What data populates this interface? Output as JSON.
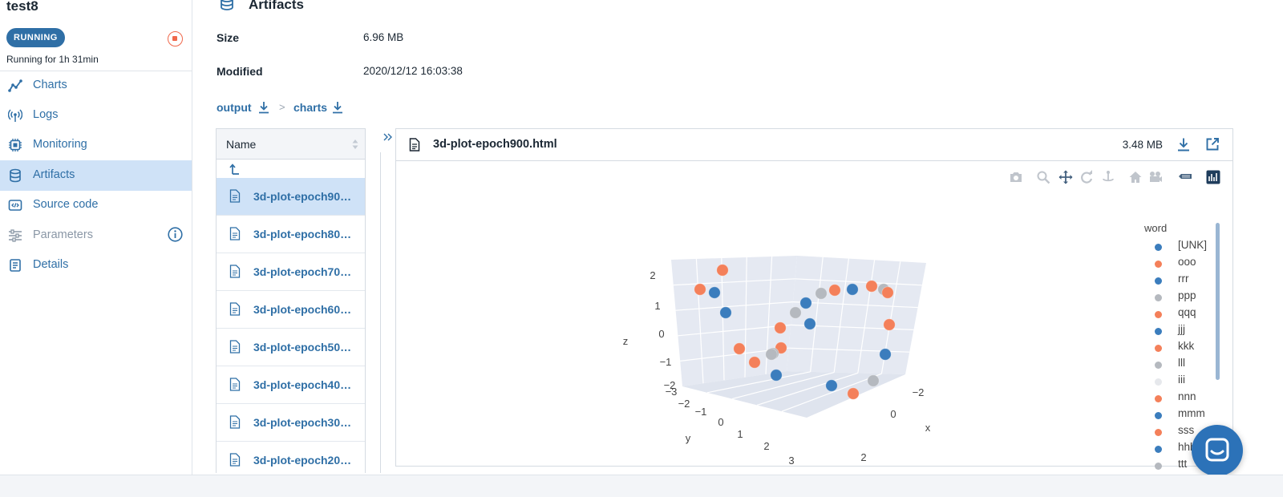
{
  "run": {
    "name": "test8",
    "status": "RUNNING",
    "running_for": "Running for 1h 31min"
  },
  "sidebar": {
    "items": [
      {
        "label": "Charts",
        "icon": "chart-line-icon",
        "state": "normal"
      },
      {
        "label": "Logs",
        "icon": "broadcast-icon",
        "state": "normal"
      },
      {
        "label": "Monitoring",
        "icon": "chip-icon",
        "state": "normal"
      },
      {
        "label": "Artifacts",
        "icon": "database-icon",
        "state": "active"
      },
      {
        "label": "Source code",
        "icon": "code-icon",
        "state": "normal"
      },
      {
        "label": "Parameters",
        "icon": "sliders-icon",
        "state": "disabled"
      },
      {
        "label": "Details",
        "icon": "document-list-icon",
        "state": "normal"
      }
    ]
  },
  "artifacts": {
    "title": "Artifacts",
    "size_label": "Size",
    "size_value": "6.96 MB",
    "modified_label": "Modified",
    "modified_value": "2020/12/12 16:03:38",
    "breadcrumb": [
      "output",
      "charts"
    ],
    "breadcrumb_separator": ">"
  },
  "file_list": {
    "header": "Name",
    "files": [
      "3d-plot-epoch90…",
      "3d-plot-epoch80…",
      "3d-plot-epoch70…",
      "3d-plot-epoch60…",
      "3d-plot-epoch50…",
      "3d-plot-epoch40…",
      "3d-plot-epoch30…",
      "3d-plot-epoch20…"
    ],
    "selected_index": 0
  },
  "preview": {
    "file_name": "3d-plot-epoch900.html",
    "size": "3.48 MB"
  },
  "modebar": [
    "camera-icon",
    "zoom-icon",
    "pan-icon",
    "orbit-rotation-icon",
    "turntable-rotation-icon",
    "home-icon",
    "camera-video-icon",
    "toggle-spike-lines-icon",
    "plotly-logo-icon"
  ],
  "colors": {
    "accent": "#2f6fa6",
    "active_bg": "#cfe2f7",
    "stop": "#f0684b",
    "blue_series": "#3b7dbd",
    "orange_series": "#f4805a",
    "gray_series": "#b5b9bf",
    "light_series": "#e6e8ec"
  },
  "chart_data": {
    "type": "scatter",
    "subtype": "scatter3d",
    "xlabel": "x",
    "ylabel": "y",
    "zlabel": "z",
    "x_ticks": [
      "−2",
      "0",
      "2"
    ],
    "y_ticks": [
      "−3",
      "−2",
      "−1",
      "0",
      "1",
      "2",
      "3"
    ],
    "z_ticks": [
      "2",
      "1",
      "0",
      "−1",
      "−2"
    ],
    "legend_title": "word",
    "legend_placement": "right",
    "series": [
      {
        "name": "[UNK]",
        "color": "#3b7dbd"
      },
      {
        "name": "ooo",
        "color": "#f4805a"
      },
      {
        "name": "rrr",
        "color": "#3b7dbd"
      },
      {
        "name": "ppp",
        "color": "#b5b9bf"
      },
      {
        "name": "qqq",
        "color": "#f4805a"
      },
      {
        "name": "jjj",
        "color": "#3b7dbd"
      },
      {
        "name": "kkk",
        "color": "#f4805a"
      },
      {
        "name": "lll",
        "color": "#b5b9bf"
      },
      {
        "name": "iii",
        "color": "#e6e8ec"
      },
      {
        "name": "nnn",
        "color": "#f4805a"
      },
      {
        "name": "mmm",
        "color": "#3b7dbd"
      },
      {
        "name": "sss",
        "color": "#f4805a"
      },
      {
        "name": "hhh",
        "color": "#3b7dbd"
      },
      {
        "name": "ttt",
        "color": "#b5b9bf"
      }
    ]
  }
}
